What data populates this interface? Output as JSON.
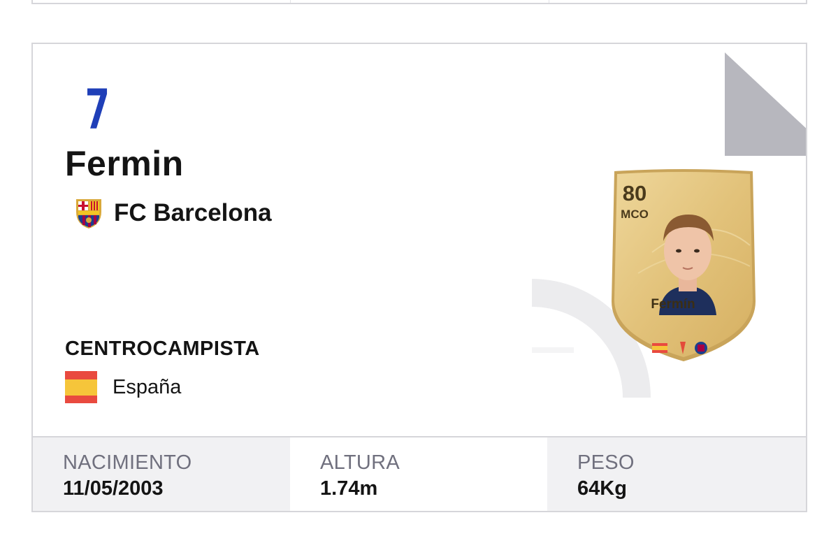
{
  "player": {
    "number": "7",
    "name": "Fermin",
    "club": "FC Barcelona",
    "position": "CENTROCAMPISTA",
    "nationality": "España"
  },
  "fut_card": {
    "rating": "80",
    "position": "MCO",
    "name": "Fermín"
  },
  "stats": {
    "birth_label": "NACIMIENTO",
    "birth_value": "11/05/2003",
    "height_label": "ALTURA",
    "height_value": "1.74m",
    "weight_label": "PESO",
    "weight_value": "64Kg"
  },
  "colors": {
    "number_blue": "#1f3fb8",
    "card_gold": "#e2c27a",
    "stat_bg": "#f1f1f3",
    "label_gray": "#70707e",
    "border": "#d6d6da"
  }
}
